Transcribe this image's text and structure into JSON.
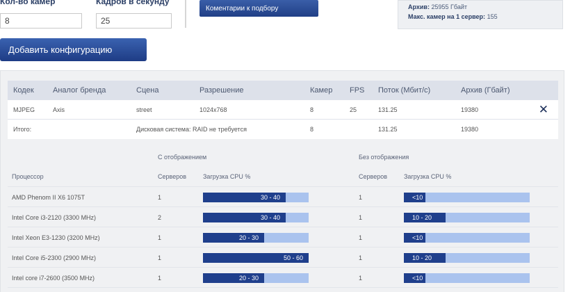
{
  "form": {
    "cameras_label": "Кол-во камер",
    "cameras_value": "8",
    "fps_label": "Кадров в секунду",
    "fps_value": "25",
    "comments_button": "Коментарии к подбору",
    "add_button": "Добавить конфигурацию"
  },
  "summary": {
    "archive_label": "Архив:",
    "archive_value": "25955 Гбайт",
    "max_cams_label": "Макс. камер на 1 сервер:",
    "max_cams_value": "155"
  },
  "config_table": {
    "headers": [
      "Кодек",
      "Аналог бренда",
      "Сцена",
      "Разрешение",
      "Камер",
      "FPS",
      "Поток (Мбит/с)",
      "Архив (Гбайт)"
    ],
    "row": [
      "MJPEG",
      "Axis",
      "street",
      "1024x768",
      "8",
      "25",
      "131.25",
      "19380"
    ],
    "total": {
      "label": "Итого:",
      "disk": "Дисковая система: RAID не требуется",
      "cameras": "8",
      "stream": "131.25",
      "archive": "19380"
    },
    "remove_icon": "close-icon"
  },
  "cpu_section": {
    "with_display": "С отображением",
    "without_display": "Без отображения",
    "processor_header": "Процессор",
    "servers_header": "Серверов",
    "load_header": "Загрузка CPU %",
    "rows": [
      {
        "name": "AMD Phenom II X6 1075T",
        "servers_with": "1",
        "load_with": "30 - 40",
        "fill_with": 0.78,
        "servers_without": "1",
        "load_without": "<10",
        "fill_without": 0.17
      },
      {
        "name": "Intel Core i3-2120 (3300 MHz)",
        "servers_with": "2",
        "load_with": "30 - 40",
        "fill_with": 0.78,
        "servers_without": "1",
        "load_without": "10 - 20",
        "fill_without": 0.33
      },
      {
        "name": "Intel Xeon E3-1230 (3200 MHz)",
        "servers_with": "1",
        "load_with": "20 - 30",
        "fill_with": 0.58,
        "servers_without": "1",
        "load_without": "<10",
        "fill_without": 0.17
      },
      {
        "name": "Intel Core i5-2300 (2900 MHz)",
        "servers_with": "1",
        "load_with": "50 - 60",
        "fill_with": 1.0,
        "servers_without": "1",
        "load_without": "10 - 20",
        "fill_without": 0.33
      },
      {
        "name": "Intel core i7-2600 (3500 MHz)",
        "servers_with": "1",
        "load_with": "20 - 30",
        "fill_with": 0.58,
        "servers_without": "1",
        "load_without": "<10",
        "fill_without": 0.17
      }
    ]
  },
  "colors": {
    "accent": "#1f3f8c",
    "bar_track": "#aac3ee",
    "panel_bg": "#f0f1f3"
  }
}
